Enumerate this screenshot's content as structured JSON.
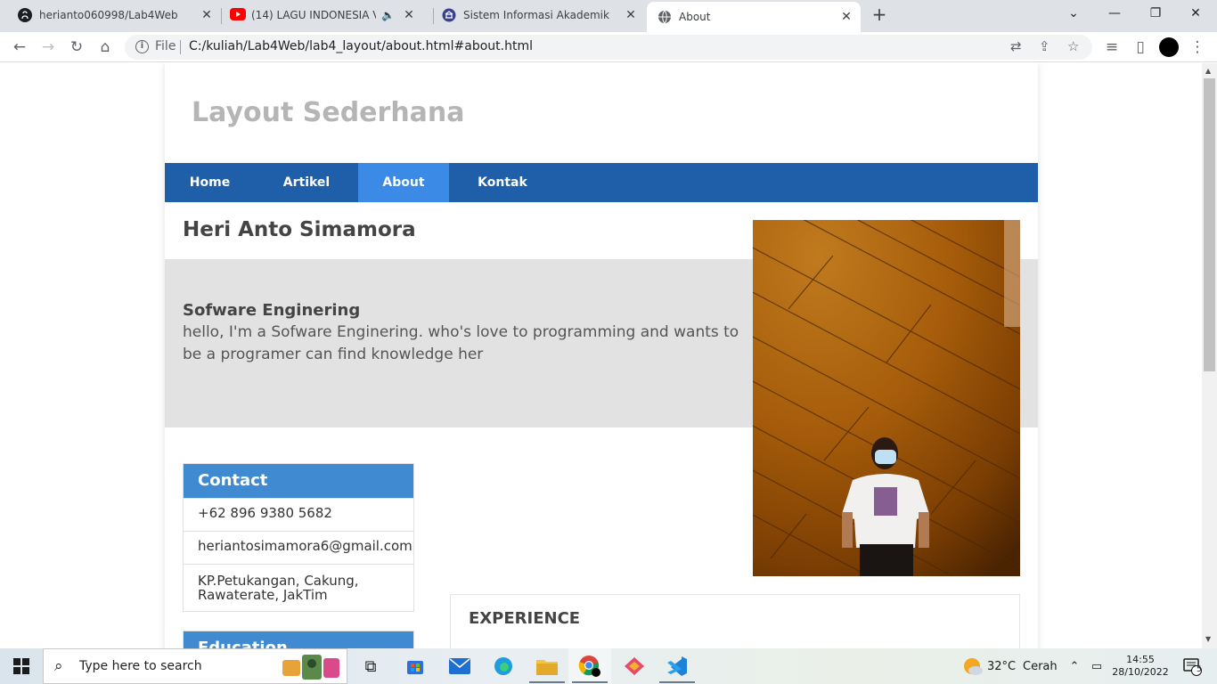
{
  "browser": {
    "tabs": [
      {
        "title": "herianto060998/Lab4Web",
        "icon": "github-icon",
        "active": false
      },
      {
        "title": "(14) LAGU INDONESIA VIRAL",
        "icon": "youtube-icon",
        "active": false
      },
      {
        "title": "Sistem Informasi Akademik",
        "icon": "university-icon",
        "active": false
      },
      {
        "title": "About",
        "icon": "globe-icon",
        "active": true
      }
    ],
    "new_tab": "+",
    "address": {
      "scheme": "File",
      "url": "C:/kuliah/Lab4Web/lab4_layout/about.html#about.html"
    }
  },
  "page": {
    "site_title": "Layout Sederhana",
    "nav": [
      {
        "label": "Home",
        "active": false
      },
      {
        "label": "Artikel",
        "active": false
      },
      {
        "label": "About",
        "active": true
      },
      {
        "label": "Kontak",
        "active": false
      }
    ],
    "name": "Heri Anto Simamora",
    "hero": {
      "title": "Sofware Enginering",
      "text": "hello, I'm a Sofware Enginering. who's love to programming and wants to be a programer can find knowledge her"
    },
    "contact": {
      "title": "Contact",
      "items": [
        "+62 896 9380 5682",
        "heriantosimamora6@gmail.com",
        "KP.Petukangan, Cakung, Rawaterate, JakTim"
      ]
    },
    "education": {
      "title": "Education"
    },
    "experience": {
      "title": "EXPERIENCE"
    }
  },
  "taskbar": {
    "search_placeholder": "Type here to search",
    "weather": {
      "temp": "32°C",
      "condition": "Cerah"
    },
    "clock": {
      "time": "14:55",
      "date": "28/10/2022"
    },
    "notification_count": "5"
  },
  "colors": {
    "nav_bg": "#1f5faa",
    "nav_active": "#3b8ae5",
    "box_head": "#3f8ad1",
    "hero_bg": "#e2e2e2"
  }
}
